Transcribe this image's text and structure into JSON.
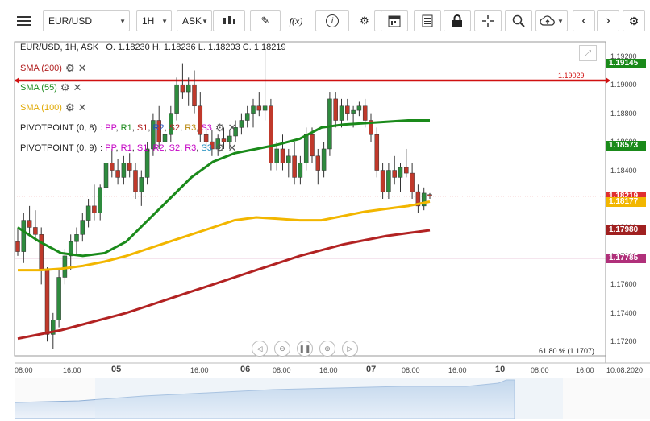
{
  "toolbar": {
    "menu_icon": "hamburger-icon",
    "symbol": "EUR/USD",
    "timeframe": "1H",
    "price_type": "ASK",
    "buttons": [
      "candle-type-icon",
      "draw-pen-icon",
      "fx-icon",
      "info-icon",
      "settings-gear-icon",
      "volume-bars-icon",
      "calendar-icon",
      "news-icon",
      "lock-icon",
      "crosshair-icon",
      "zoom-icon",
      "cloud-upload-icon",
      "arrow-left-icon",
      "arrow-right-icon"
    ],
    "fx_label": "f(x)"
  },
  "info_line": "EUR/USD, 1H, ASK   O. 1.18230 H. 1.18236 L. 1.18203 C. 1.18219",
  "indicators": [
    {
      "label": "SMA (200)",
      "color": "#b22222"
    },
    {
      "label": "SMA (55)",
      "color": "#1a8a1a"
    },
    {
      "label": "SMA (100)",
      "color": "#f2b600"
    }
  ],
  "pivots": [
    {
      "label": "PIVOTPOINT (0, 8)",
      "parts": [
        "PP",
        "R1",
        "S1",
        "R2",
        "S2",
        "R3",
        "S3"
      ]
    },
    {
      "label": "PIVOTPOINT (0, 9)",
      "parts": [
        "PP",
        "R1",
        "S1",
        "R2",
        "S2",
        "R3",
        "S3"
      ]
    }
  ],
  "pivot_colors": [
    "#c400c4",
    "#1a8a1a",
    "#b22222",
    "#1f4fbf",
    "#b22222",
    "#b8860b",
    "#c400c4"
  ],
  "y_axis": [
    "1.19200",
    "1.19000",
    "1.18800",
    "1.18600",
    "1.18400",
    "1.18200",
    "1.18000",
    "1.17800",
    "1.17600",
    "1.17400",
    "1.17200"
  ],
  "price_tags": [
    {
      "value": "1.19145",
      "color": "#1a8a1a"
    },
    {
      "value": "1.18573",
      "color": "#1a8a1a"
    },
    {
      "value": "1.18219",
      "color": "#e03030"
    },
    {
      "value": "1.18177",
      "color": "#f2b600"
    },
    {
      "value": "1.17980",
      "color": "#a02020"
    },
    {
      "value": "1.17785",
      "color": "#b0307a"
    }
  ],
  "hline_label": "1.19029",
  "fib_label": "61.80 % (1.1707)",
  "x_axis": [
    {
      "label": "08:00",
      "day": false
    },
    {
      "label": "16:00",
      "day": false
    },
    {
      "label": "05",
      "day": true
    },
    {
      "label": "16:00",
      "day": false
    },
    {
      "label": "06",
      "day": true
    },
    {
      "label": "08:00",
      "day": false
    },
    {
      "label": "16:00",
      "day": false
    },
    {
      "label": "07",
      "day": true
    },
    {
      "label": "08:00",
      "day": false
    },
    {
      "label": "16:00",
      "day": false
    },
    {
      "label": "10",
      "day": true
    },
    {
      "label": "08:00",
      "day": false
    },
    {
      "label": "16:00",
      "day": false
    },
    {
      "label": "10.08.2020",
      "day": false
    }
  ],
  "nav_buttons": [
    "rewind-icon",
    "zoom-out-icon",
    "pause-icon",
    "zoom-in-icon",
    "play-icon"
  ],
  "chart_data": {
    "type": "candlestick",
    "ylim": [
      1.171,
      1.193
    ],
    "candles": [
      [
        1.179,
        1.18,
        1.178,
        1.1783
      ],
      [
        1.1783,
        1.181,
        1.1775,
        1.1805
      ],
      [
        1.1805,
        1.1815,
        1.1795,
        1.18
      ],
      [
        1.18,
        1.1812,
        1.179,
        1.1795
      ],
      [
        1.1795,
        1.18,
        1.176,
        1.177
      ],
      [
        1.177,
        1.1772,
        1.172,
        1.1725
      ],
      [
        1.1725,
        1.174,
        1.1715,
        1.1735
      ],
      [
        1.1735,
        1.177,
        1.173,
        1.1765
      ],
      [
        1.1765,
        1.1785,
        1.176,
        1.178
      ],
      [
        1.178,
        1.1795,
        1.177,
        1.179
      ],
      [
        1.179,
        1.18,
        1.178,
        1.1795
      ],
      [
        1.1795,
        1.181,
        1.179,
        1.1805
      ],
      [
        1.1805,
        1.182,
        1.18,
        1.1815
      ],
      [
        1.1815,
        1.183,
        1.1805,
        1.181
      ],
      [
        1.181,
        1.183,
        1.1805,
        1.1828
      ],
      [
        1.1828,
        1.185,
        1.182,
        1.1845
      ],
      [
        1.1845,
        1.1855,
        1.1835,
        1.184
      ],
      [
        1.184,
        1.1848,
        1.183,
        1.1835
      ],
      [
        1.1835,
        1.185,
        1.183,
        1.1845
      ],
      [
        1.1845,
        1.1852,
        1.1835,
        1.184
      ],
      [
        1.184,
        1.1845,
        1.182,
        1.1825
      ],
      [
        1.1825,
        1.184,
        1.1815,
        1.1835
      ],
      [
        1.1835,
        1.186,
        1.183,
        1.1855
      ],
      [
        1.1855,
        1.188,
        1.185,
        1.1875
      ],
      [
        1.1875,
        1.1885,
        1.1855,
        1.186
      ],
      [
        1.186,
        1.187,
        1.185,
        1.1865
      ],
      [
        1.1865,
        1.1885,
        1.186,
        1.188
      ],
      [
        1.188,
        1.1905,
        1.1875,
        1.19
      ],
      [
        1.19,
        1.1915,
        1.189,
        1.1895
      ],
      [
        1.1895,
        1.1905,
        1.1885,
        1.19
      ],
      [
        1.19,
        1.191,
        1.188,
        1.1885
      ],
      [
        1.1885,
        1.1895,
        1.186,
        1.1865
      ],
      [
        1.1865,
        1.187,
        1.1855,
        1.186
      ],
      [
        1.186,
        1.1868,
        1.185,
        1.1855
      ],
      [
        1.1855,
        1.1865,
        1.185,
        1.1862
      ],
      [
        1.1862,
        1.187,
        1.1855,
        1.186
      ],
      [
        1.186,
        1.1868,
        1.1855,
        1.1864
      ],
      [
        1.1864,
        1.1875,
        1.186,
        1.187
      ],
      [
        1.187,
        1.188,
        1.1865,
        1.1875
      ],
      [
        1.1875,
        1.1885,
        1.187,
        1.188
      ],
      [
        1.188,
        1.189,
        1.187,
        1.1885
      ],
      [
        1.1885,
        1.1895,
        1.1878,
        1.1882
      ],
      [
        1.1882,
        1.1925,
        1.1875,
        1.1885
      ],
      [
        1.1885,
        1.189,
        1.184,
        1.1845
      ],
      [
        1.1845,
        1.186,
        1.184,
        1.1855
      ],
      [
        1.1855,
        1.1865,
        1.184,
        1.1845
      ],
      [
        1.1845,
        1.1855,
        1.1835,
        1.185
      ],
      [
        1.185,
        1.186,
        1.183,
        1.1835
      ],
      [
        1.1835,
        1.185,
        1.183,
        1.1845
      ],
      [
        1.1845,
        1.187,
        1.184,
        1.1865
      ],
      [
        1.1865,
        1.187,
        1.1845,
        1.185
      ],
      [
        1.185,
        1.1855,
        1.183,
        1.184
      ],
      [
        1.184,
        1.186,
        1.1835,
        1.1855
      ],
      [
        1.1855,
        1.1895,
        1.185,
        1.189
      ],
      [
        1.189,
        1.1895,
        1.187,
        1.1875
      ],
      [
        1.1875,
        1.189,
        1.187,
        1.1885
      ],
      [
        1.1885,
        1.189,
        1.1875,
        1.188
      ],
      [
        1.188,
        1.1885,
        1.187,
        1.1882
      ],
      [
        1.1882,
        1.1888,
        1.1878,
        1.1885
      ],
      [
        1.1885,
        1.189,
        1.187,
        1.1875
      ],
      [
        1.1875,
        1.188,
        1.186,
        1.1865
      ],
      [
        1.1865,
        1.187,
        1.1835,
        1.184
      ],
      [
        1.184,
        1.1845,
        1.182,
        1.1825
      ],
      [
        1.1825,
        1.1845,
        1.182,
        1.184
      ],
      [
        1.184,
        1.185,
        1.183,
        1.1835
      ],
      [
        1.1835,
        1.1845,
        1.1825,
        1.1842
      ],
      [
        1.1842,
        1.1855,
        1.1835,
        1.1838
      ],
      [
        1.1838,
        1.1845,
        1.182,
        1.1825
      ],
      [
        1.1825,
        1.183,
        1.181,
        1.1815
      ],
      [
        1.1815,
        1.1828,
        1.1812,
        1.1824
      ],
      [
        1.1823,
        1.1824,
        1.182,
        1.1822
      ]
    ],
    "sma200": [
      1.1722,
      1.1725,
      1.1728,
      1.1732,
      1.1736,
      1.174,
      1.1745,
      1.175,
      1.1755,
      1.176,
      1.1765,
      1.177,
      1.1775,
      1.178,
      1.1784,
      1.1788,
      1.1791,
      1.1794,
      1.1796,
      1.1798
    ],
    "sma55": [
      1.18,
      1.179,
      1.1782,
      1.178,
      1.1782,
      1.179,
      1.1805,
      1.182,
      1.1835,
      1.1846,
      1.1852,
      1.1855,
      1.1858,
      1.1862,
      1.187,
      1.1872,
      1.1873,
      1.1874,
      1.1875,
      1.1875
    ],
    "sma100": [
      1.177,
      1.177,
      1.1771,
      1.1773,
      1.1776,
      1.178,
      1.1785,
      1.179,
      1.1795,
      1.18,
      1.1805,
      1.1807,
      1.1806,
      1.1805,
      1.1805,
      1.1808,
      1.1811,
      1.1813,
      1.1815,
      1.1818
    ],
    "levels": [
      1.19145,
      1.19029,
      1.17785
    ]
  }
}
